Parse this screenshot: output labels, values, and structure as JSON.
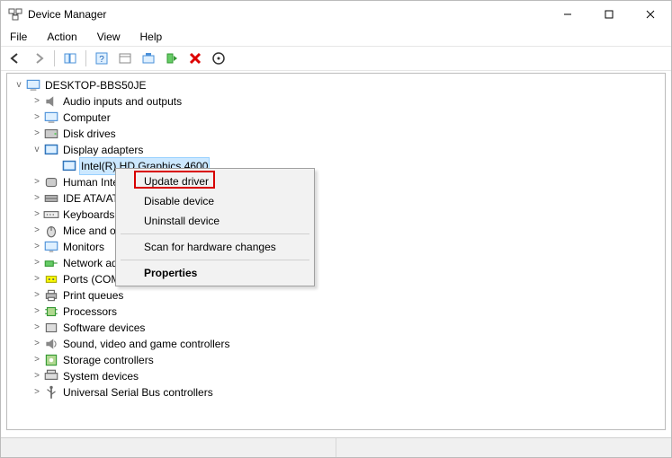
{
  "window": {
    "title": "Device Manager"
  },
  "menu": {
    "file": "File",
    "action": "Action",
    "view": "View",
    "help": "Help"
  },
  "toolbar_icons": {
    "back": "back-arrow-icon",
    "forward": "forward-arrow-icon",
    "show_hide": "show-hide-console-tree-icon",
    "help": "help-icon",
    "properties": "properties-icon",
    "update": "update-driver-icon",
    "enable": "enable-device-icon",
    "uninstall": "uninstall-device-icon",
    "scan": "scan-for-hardware-changes-icon"
  },
  "root": {
    "label": "DESKTOP-BBS50JE"
  },
  "categories": [
    {
      "label": "Audio inputs and outputs",
      "icon": "audio-icon",
      "expanded": false
    },
    {
      "label": "Computer",
      "icon": "computer-icon",
      "expanded": false
    },
    {
      "label": "Disk drives",
      "icon": "disk-drive-icon",
      "expanded": false
    },
    {
      "label": "Display adapters",
      "icon": "display-adapter-icon",
      "expanded": true,
      "children": [
        {
          "label": "Intel(R) HD Graphics 4600",
          "icon": "display-adapter-icon"
        }
      ]
    },
    {
      "label": "Human Interface Devices",
      "icon": "hid-icon",
      "expanded": false
    },
    {
      "label": "IDE ATA/ATAPI controllers",
      "icon": "ide-controller-icon",
      "expanded": false
    },
    {
      "label": "Keyboards",
      "icon": "keyboard-icon",
      "expanded": false
    },
    {
      "label": "Mice and other pointing devices",
      "icon": "mouse-icon",
      "expanded": false
    },
    {
      "label": "Monitors",
      "icon": "monitor-icon",
      "expanded": false
    },
    {
      "label": "Network adapters",
      "icon": "network-adapter-icon",
      "expanded": false
    },
    {
      "label": "Ports (COM & LPT)",
      "icon": "port-icon",
      "expanded": false
    },
    {
      "label": "Print queues",
      "icon": "printer-icon",
      "expanded": false
    },
    {
      "label": "Processors",
      "icon": "processor-icon",
      "expanded": false
    },
    {
      "label": "Software devices",
      "icon": "software-device-icon",
      "expanded": false
    },
    {
      "label": "Sound, video and game controllers",
      "icon": "sound-controller-icon",
      "expanded": false
    },
    {
      "label": "Storage controllers",
      "icon": "storage-controller-icon",
      "expanded": false
    },
    {
      "label": "System devices",
      "icon": "system-device-icon",
      "expanded": false
    },
    {
      "label": "Universal Serial Bus controllers",
      "icon": "usb-controller-icon",
      "expanded": false
    }
  ],
  "context_menu": {
    "update": "Update driver",
    "disable": "Disable device",
    "uninstall": "Uninstall device",
    "scan": "Scan for hardware changes",
    "properties": "Properties",
    "highlighted": "update"
  },
  "colors": {
    "selection": "#cce8ff",
    "highlight_box": "#d80000"
  }
}
